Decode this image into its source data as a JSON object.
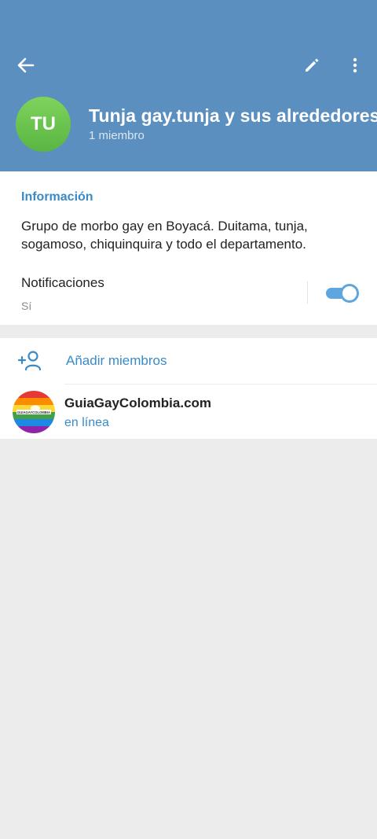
{
  "header": {
    "back_icon": "arrow-left-icon",
    "edit_icon": "pencil-icon",
    "more_icon": "vertical-dots-icon",
    "avatar_initials": "TU",
    "title": "Tunja gay.tunja y sus alrededores",
    "subtitle": "1 miembro"
  },
  "info": {
    "heading": "Información",
    "description": "Grupo de morbo gay en Boyacá. Duitama, tunja, sogamoso, chiquinquira y todo el departamento.",
    "notifications_label": "Notificaciones",
    "notifications_value": "Sí",
    "notifications_enabled": true
  },
  "members": {
    "add_icon": "add-person-icon",
    "add_label": "Añadir miembros",
    "items": [
      {
        "name": "GuiaGayColombia.com",
        "status": "en línea",
        "avatar_text": "GUIAGAYCOLOMBIA"
      }
    ]
  },
  "colors": {
    "header_bg": "#5b8fbf",
    "accent": "#3a8ac6",
    "toggle": "#5da6df",
    "avatar_green": "#6cc44f",
    "page_bg": "#ececec"
  }
}
